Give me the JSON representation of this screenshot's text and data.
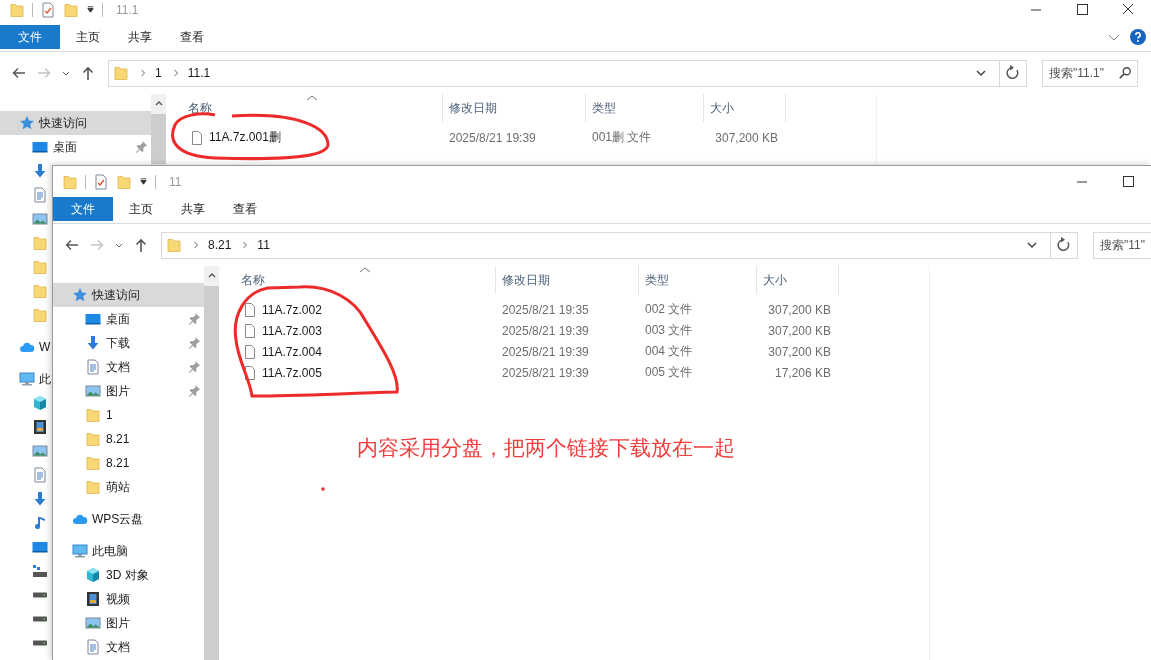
{
  "back_window": {
    "title": "11.1",
    "ribbon": [
      {
        "label": "文件",
        "kind": "file"
      },
      {
        "label": "主页",
        "kind": "tab"
      },
      {
        "label": "共享",
        "kind": "tab"
      },
      {
        "label": "查看",
        "kind": "tab"
      }
    ],
    "path": [
      "1",
      "11.1"
    ],
    "search": {
      "placeholder": "搜索\"11.1\""
    },
    "nav": [
      {
        "label": "快速访问",
        "kind": "star",
        "selected": true,
        "children": [
          {
            "label": "桌面",
            "kind": "desktop",
            "pinned": true
          },
          {
            "kind": "download"
          },
          {
            "kind": "doc"
          },
          {
            "kind": "picture"
          },
          {
            "kind": "folder"
          },
          {
            "kind": "folder"
          },
          {
            "kind": "folder"
          },
          {
            "kind": "folder"
          }
        ]
      },
      {
        "label": "W",
        "kind": "cloud",
        "selected": false
      },
      {
        "label": "此",
        "kind": "pc",
        "selected": false,
        "children": [
          {
            "kind": "cube"
          },
          {
            "kind": "video"
          },
          {
            "kind": "picture"
          },
          {
            "kind": "doc"
          },
          {
            "kind": "download"
          },
          {
            "kind": "music"
          },
          {
            "kind": "desktop"
          },
          {
            "kind": "netdrive"
          },
          {
            "kind": "drive"
          },
          {
            "kind": "drive"
          },
          {
            "kind": "drive"
          }
        ]
      }
    ],
    "columns": [
      "名称",
      "修改日期",
      "类型",
      "大小"
    ],
    "files": [
      {
        "name": "11A.7z.001删",
        "modified": "2025/8/21 19:39",
        "type": "001删 文件",
        "size": "307,200 KB"
      }
    ]
  },
  "front_window": {
    "title": "11",
    "ribbon": [
      {
        "label": "文件",
        "kind": "file"
      },
      {
        "label": "主页",
        "kind": "tab"
      },
      {
        "label": "共享",
        "kind": "tab"
      },
      {
        "label": "查看",
        "kind": "tab"
      }
    ],
    "path": [
      "8.21",
      "11"
    ],
    "search": {
      "placeholder": "搜索\"11\""
    },
    "nav": [
      {
        "label": "快速访问",
        "kind": "star",
        "selected": true,
        "children": [
          {
            "label": "桌面",
            "kind": "desktop",
            "pinned": true
          },
          {
            "label": "下载",
            "kind": "download",
            "pinned": true
          },
          {
            "label": "文档",
            "kind": "doc",
            "pinned": true
          },
          {
            "label": "图片",
            "kind": "picture",
            "pinned": true
          },
          {
            "label": "1",
            "kind": "folder",
            "pinned": false
          },
          {
            "label": "8.21",
            "kind": "folder",
            "pinned": false
          },
          {
            "label": "8.21",
            "kind": "folder",
            "pinned": false
          },
          {
            "label": "萌站",
            "kind": "folder",
            "pinned": false
          }
        ]
      },
      {
        "label": "WPS云盘",
        "kind": "cloud",
        "selected": false
      },
      {
        "label": "此电脑",
        "kind": "pc",
        "selected": false,
        "children": [
          {
            "label": "3D 对象",
            "kind": "cube",
            "pinned": false
          },
          {
            "label": "视频",
            "kind": "video",
            "pinned": false
          },
          {
            "label": "图片",
            "kind": "picture",
            "pinned": false
          },
          {
            "label": "文档",
            "kind": "doc",
            "pinned": false
          }
        ]
      }
    ],
    "columns": [
      "名称",
      "修改日期",
      "类型",
      "大小"
    ],
    "files": [
      {
        "name": "11A.7z.002",
        "modified": "2025/8/21 19:35",
        "type": "002 文件",
        "size": "307,200 KB"
      },
      {
        "name": "11A.7z.003",
        "modified": "2025/8/21 19:39",
        "type": "003 文件",
        "size": "307,200 KB"
      },
      {
        "name": "11A.7z.004",
        "modified": "2025/8/21 19:39",
        "type": "004 文件",
        "size": "307,200 KB"
      },
      {
        "name": "11A.7z.005",
        "modified": "2025/8/21 19:39",
        "type": "005 文件",
        "size": "17,206 KB"
      }
    ]
  },
  "annotation": {
    "text": "内容采用分盘，把两个链接下载放在一起"
  }
}
